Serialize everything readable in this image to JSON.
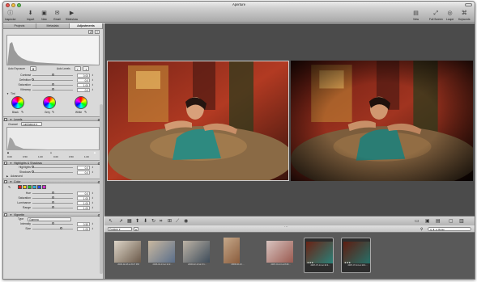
{
  "window": {
    "title": "Aperture"
  },
  "toolbar": {
    "left": [
      {
        "label": "Inspector",
        "icon": "inspector-icon"
      },
      {
        "label": "Import",
        "icon": "import-icon"
      },
      {
        "label": "New",
        "icon": "new-icon"
      },
      {
        "label": "Email",
        "icon": "email-icon"
      },
      {
        "label": "Slideshow",
        "icon": "slideshow-icon"
      }
    ],
    "right": [
      {
        "label": "View",
        "icon": "view-icon"
      },
      {
        "label": "Full Screen",
        "icon": "full-screen-icon"
      },
      {
        "label": "Loupe",
        "icon": "loupe-icon"
      },
      {
        "label": "Keywords",
        "icon": "keywords-icon"
      }
    ]
  },
  "inspector": {
    "tabs": [
      "Projects",
      "Metadata",
      "Adjustments"
    ],
    "active_tab": "Adjustments",
    "auto_exposure_label": "Auto Exposure",
    "auto_levels_label": "Auto Levels",
    "exposure_rows": [
      {
        "label": "Contrast",
        "value": "0.00",
        "pos": 0.5
      },
      {
        "label": "Definition",
        "value": "0.0",
        "pos": 0.0
      },
      {
        "label": "Saturation",
        "value": "1.00",
        "pos": 0.5
      },
      {
        "label": "Vibrancy",
        "value": "0.0",
        "pos": 0.5
      }
    ],
    "tint": {
      "label": "Tint",
      "wheels": [
        {
          "label": "Black",
          "color": "#1a1a1a"
        },
        {
          "label": "Grey",
          "color": "#7a7a7a"
        },
        {
          "label": "White",
          "color": "#f2f2f2"
        }
      ]
    },
    "levels": {
      "title": "Levels",
      "channel_label": "Channel",
      "channel_value": "Luminance",
      "values": [
        "0.00",
        "0.50",
        "1.00",
        "0.00",
        "0.50",
        "1.00"
      ]
    },
    "highlights": {
      "title": "Highlights & Shadows",
      "rows": [
        {
          "label": "Highlights",
          "value": "0.0",
          "pos": 0.0
        },
        {
          "label": "Shadows",
          "value": "0.0",
          "pos": 0.0
        }
      ],
      "advanced_label": "Advanced"
    },
    "color": {
      "title": "Color",
      "swatches": [
        "#e02020",
        "#f0d020",
        "#30c030",
        "#30b0e0",
        "#3050e0",
        "#d030d0"
      ],
      "rows": [
        {
          "label": "Hue",
          "value": "0.0",
          "pos": 0.5
        },
        {
          "label": "Saturation",
          "value": "1.00",
          "pos": 0.5
        },
        {
          "label": "Luminance",
          "value": "1.00",
          "pos": 0.5
        },
        {
          "label": "Range",
          "value": "1.00",
          "pos": 0.5
        }
      ]
    },
    "vignette": {
      "title": "Vignette",
      "type_label": "Type",
      "type_value": "Gamma",
      "rows": [
        {
          "label": "Intensity",
          "value": "0.50",
          "pos": 0.5
        },
        {
          "label": "Size",
          "value": "1.00",
          "pos": 0.7
        }
      ]
    }
  },
  "browser_bar": {
    "sort_value": "Custom",
    "search_value": "Q ★ or Better"
  },
  "filmstrip": [
    {
      "caption": "2006-02-26 at 8:27 PM",
      "selected": false
    },
    {
      "caption": "2006-02-13 at 11:2...",
      "selected": false
    },
    {
      "caption": "2006-02-13 at 3:1...",
      "selected": false
    },
    {
      "caption": "2006-02-13 ...",
      "selected": false
    },
    {
      "caption": "2007-01-13 at 8:29...",
      "selected": false
    },
    {
      "caption": "2007-07-14 at 10:4...",
      "selected": true,
      "stars": "★★★"
    },
    {
      "caption": "2007-07-14 at 10:4...",
      "selected": true,
      "stars": "★★★"
    }
  ],
  "colors": {
    "viewer_bg": "#4b4b4b",
    "strip_bg": "#595959",
    "panel_bg": "#d9d9d9"
  }
}
